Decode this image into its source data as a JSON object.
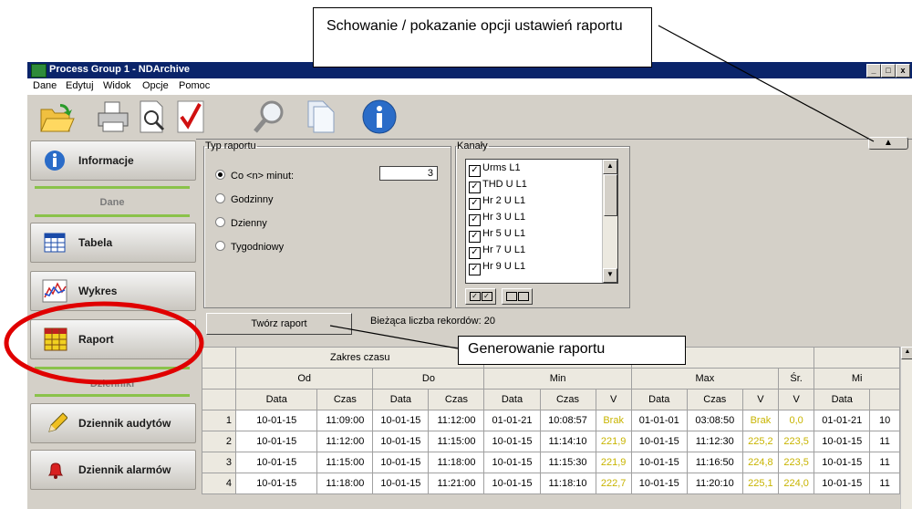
{
  "window": {
    "title": "Process Group 1 - NDArchive",
    "min_label": "_",
    "max_label": "□",
    "close_label": "x"
  },
  "menu": [
    "Dane",
    "Edytuj",
    "Widok",
    "Opcje",
    "Pomoc"
  ],
  "toolbar": [
    "open-folder-icon",
    "print-icon",
    "preview-icon",
    "check-icon",
    "search-icon",
    "copy-icon",
    "info-icon"
  ],
  "sidebar": {
    "informacje": "Informacje",
    "section_dane": "Dane",
    "tabela": "Tabela",
    "wykres": "Wykres",
    "raport": "Raport",
    "section_dzienniki": "Dzienniki",
    "audyt": "Dziennik audytów",
    "alarmy": "Dziennik alarmów"
  },
  "report_type": {
    "legend": "Typ raportu",
    "options": [
      "Co <n> minut:",
      "Godzinny",
      "Dzienny",
      "Tygodniowy"
    ],
    "selected": 0,
    "minutes_value": "3"
  },
  "channels": {
    "legend": "Kanały",
    "items": [
      "Urms L1",
      "THD U L1",
      "Hr 2 U L1",
      "Hr 3 U L1",
      "Hr 5 U L1",
      "Hr 7 U L1",
      "Hr 9 U L1"
    ]
  },
  "create_button": "Twórz raport",
  "record_count": "Bieżąca liczba rekordów: 20",
  "collapse_toggle": "▲",
  "callouts": {
    "toggle": "Schowanie / pokazanie opcji ustawień raportu",
    "generate": "Generowanie raportu"
  },
  "table": {
    "group1": "Zakres czasu",
    "sub": [
      "Od",
      "Do",
      "Min",
      "Max",
      "Śr.",
      "Mi"
    ],
    "cols": [
      "Data",
      "Czas",
      "Data",
      "Czas",
      "Data",
      "Czas",
      "V",
      "Data",
      "Czas",
      "V",
      "V",
      "Data",
      ""
    ],
    "rows": [
      [
        "1",
        "10-01-15",
        "11:09:00",
        "10-01-15",
        "11:12:00",
        "01-01-21",
        "10:08:57",
        "Brak",
        "01-01-01",
        "03:08:50",
        "Brak",
        "0,0",
        "01-01-21",
        "10"
      ],
      [
        "2",
        "10-01-15",
        "11:12:00",
        "10-01-15",
        "11:15:00",
        "10-01-15",
        "11:14:10",
        "221,9",
        "10-01-15",
        "11:12:30",
        "225,2",
        "223,5",
        "10-01-15",
        "11"
      ],
      [
        "3",
        "10-01-15",
        "11:15:00",
        "10-01-15",
        "11:18:00",
        "10-01-15",
        "11:15:30",
        "221,9",
        "10-01-15",
        "11:16:50",
        "224,8",
        "223,5",
        "10-01-15",
        "11"
      ],
      [
        "4",
        "10-01-15",
        "11:18:00",
        "10-01-15",
        "11:21:00",
        "10-01-15",
        "11:18:10",
        "222,7",
        "10-01-15",
        "11:20:10",
        "225,1",
        "224,0",
        "10-01-15",
        "11"
      ]
    ]
  }
}
